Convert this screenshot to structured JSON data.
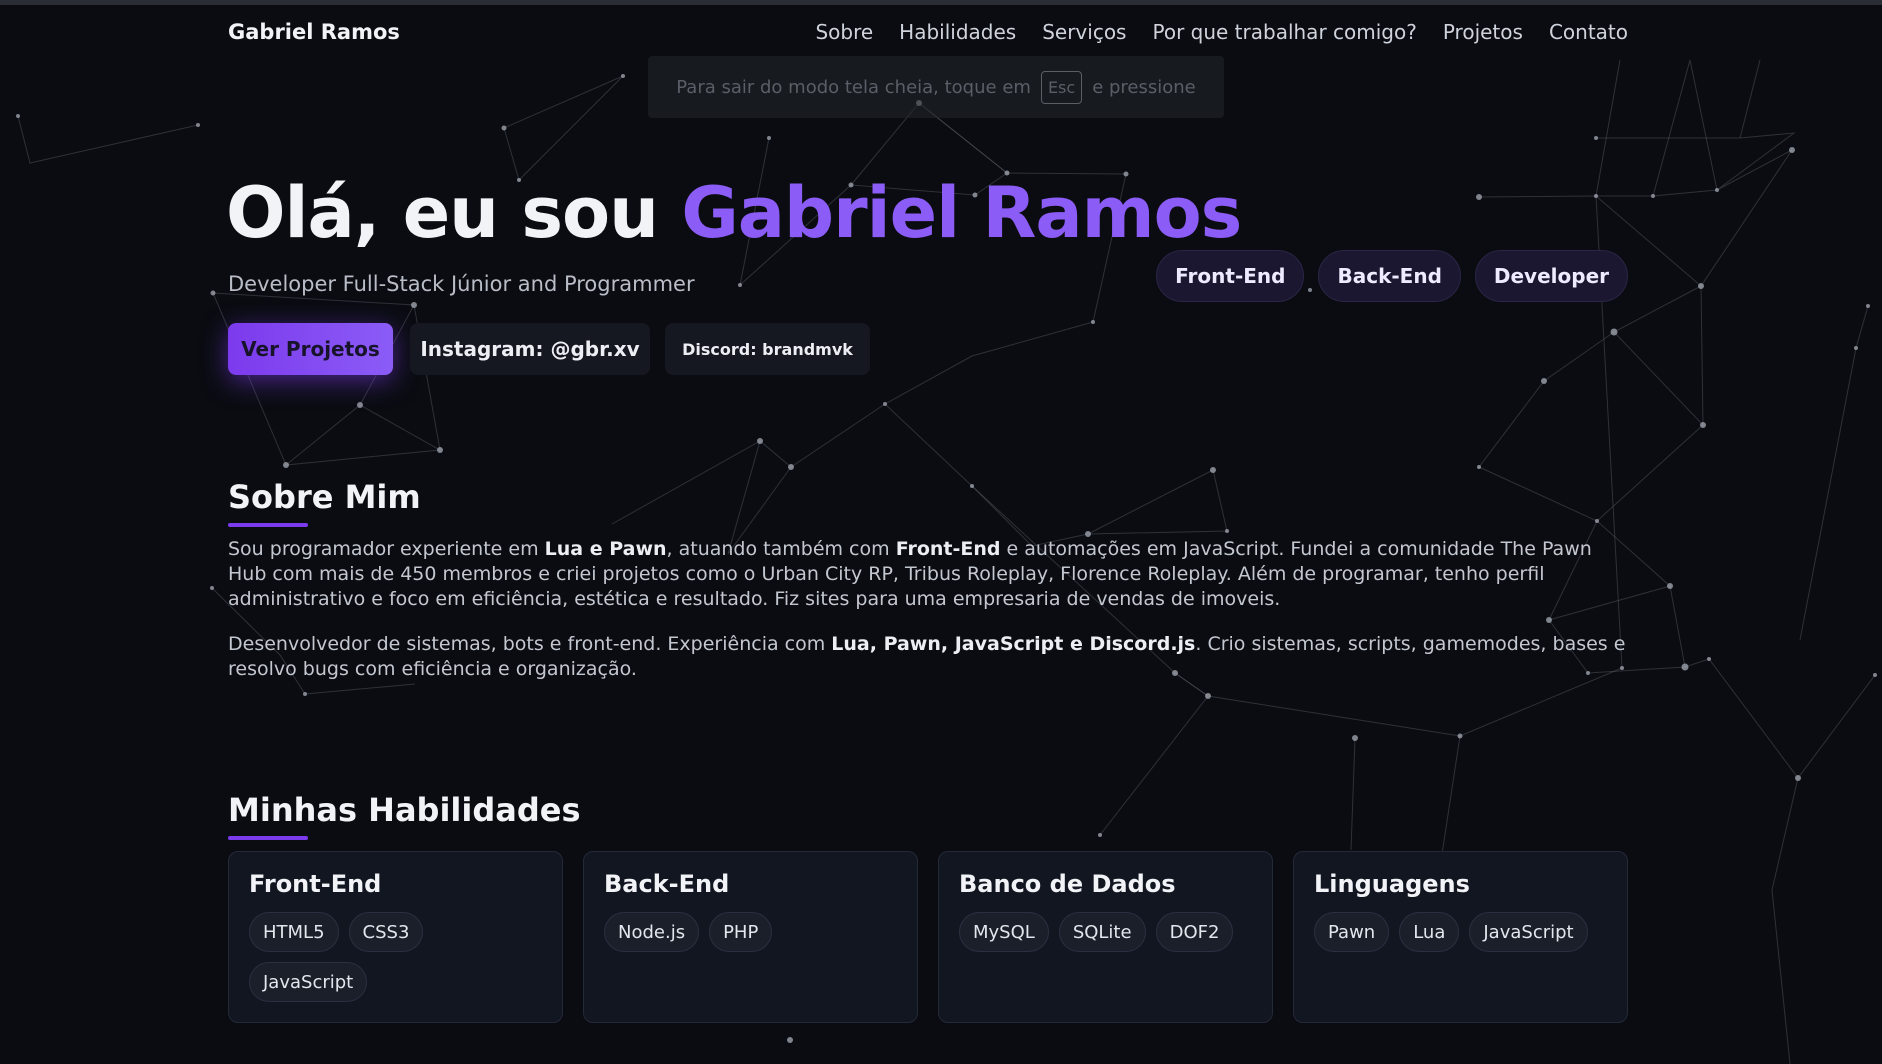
{
  "nav": {
    "brand": "Gabriel Ramos",
    "links": [
      "Sobre",
      "Habilidades",
      "Serviços",
      "Por que trabalhar comigo?",
      "Projetos",
      "Contato"
    ]
  },
  "fullscreen_hint": {
    "before": "Para sair do modo tela cheia, toque em",
    "key": "Esc",
    "after": "e pressione"
  },
  "hero": {
    "title_prefix": "Olá, eu sou ",
    "title_name": "Gabriel Ramos",
    "subtitle": "Developer Full-Stack Júnior and Programmer",
    "buttons": {
      "projects": "Ver Projetos",
      "instagram": "Instagram: @gbr.xv",
      "discord": "Discord: brandmvk"
    },
    "tags": [
      "Front-End",
      "Back-End",
      "Developer"
    ]
  },
  "about": {
    "title": "Sobre Mim",
    "p1": [
      {
        "t": "Sou programador experiente em ",
        "b": false
      },
      {
        "t": "Lua e Pawn",
        "b": true
      },
      {
        "t": ", atuando também com ",
        "b": false
      },
      {
        "t": "Front-End",
        "b": true
      },
      {
        "t": " e automações em JavaScript. Fundei a comunidade The Pawn Hub com mais de 450 membros e criei projetos como o Urban City RP, Tribus Roleplay, Florence Roleplay. Além de programar, tenho perfil administrativo e foco em eficiência, estética e resultado. Fiz sites para uma empresaria de vendas de imoveis.",
        "b": false
      }
    ],
    "p2": [
      {
        "t": "Desenvolvedor de sistemas, bots e front-end. Experiência com ",
        "b": false
      },
      {
        "t": "Lua, Pawn, JavaScript e Discord.js",
        "b": true
      },
      {
        "t": ". Crio sistemas, scripts, gamemodes, bases e resolvo bugs com eficiência e organização.",
        "b": false
      }
    ]
  },
  "skills": {
    "title": "Minhas Habilidades",
    "cards": [
      {
        "title": "Front-End",
        "items": [
          "HTML5",
          "CSS3",
          "JavaScript"
        ]
      },
      {
        "title": "Back-End",
        "items": [
          "Node.js",
          "PHP"
        ]
      },
      {
        "title": "Banco de Dados",
        "items": [
          "MySQL",
          "SQLite",
          "DOF2"
        ]
      },
      {
        "title": "Linguagens",
        "items": [
          "Pawn",
          "Lua",
          "JavaScript"
        ]
      }
    ]
  },
  "colors": {
    "background": "#0a0c11",
    "accent": "#8b5cf6",
    "card": "#111620"
  }
}
